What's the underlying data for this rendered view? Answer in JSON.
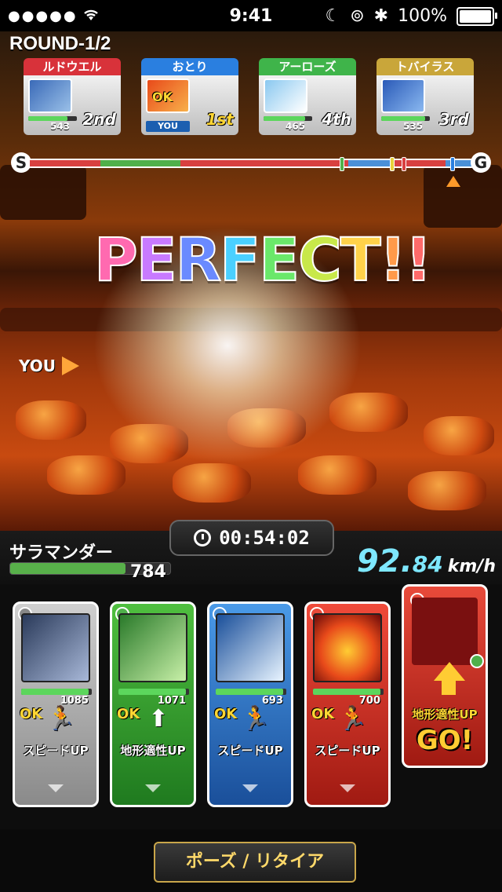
{
  "status_bar": {
    "time": "9:41",
    "battery_label": "100%",
    "battery_level_percent": 100,
    "signal_dots": "●●●●●"
  },
  "race": {
    "round_label": "ROUND-1/2",
    "perfect_text": "PERFECT!!",
    "you_pointer_label": "YOU",
    "start_cap": "S",
    "goal_cap": "G",
    "racers": [
      {
        "name": "ルドウエル",
        "hp": "543",
        "rank": "2nd",
        "plate_color": "#d8323a",
        "hp_fraction": 0.8
      },
      {
        "name": "おとり",
        "hp": "",
        "rank": "1st",
        "plate_color": "#2a7fe0",
        "you_label": "YOU",
        "ok_label": "OK",
        "hp_fraction": 1.0
      },
      {
        "name": "アーローズ",
        "hp": "465",
        "rank": "4th",
        "plate_color": "#3fb44a",
        "hp_fraction": 0.85
      },
      {
        "name": "トバイラス",
        "hp": "535",
        "rank": "3rd",
        "plate_color": "#c9a63a",
        "hp_fraction": 0.9
      }
    ],
    "progress_segments": [
      {
        "from": 0.0,
        "to": 0.08,
        "color": "#d84040"
      },
      {
        "from": 0.08,
        "to": 0.16,
        "color": "#d84040"
      },
      {
        "from": 0.16,
        "to": 0.34,
        "color": "#4fb04a"
      },
      {
        "from": 0.34,
        "to": 0.72,
        "color": "#d84040"
      },
      {
        "from": 0.72,
        "to": 0.82,
        "color": "#4a90d8"
      },
      {
        "from": 0.82,
        "to": 0.94,
        "color": "#d84040"
      },
      {
        "from": 0.94,
        "to": 1.0,
        "color": "#4a90d8"
      }
    ],
    "progress_markers": [
      {
        "position": 0.705,
        "color": "#4fb04a"
      },
      {
        "position": 0.82,
        "color": "#e8d23a"
      },
      {
        "position": 0.845,
        "color": "#d84040"
      },
      {
        "position": 0.955,
        "color": "#2a7fe0"
      }
    ],
    "you_position": 0.955
  },
  "player": {
    "name": "サラマンダー",
    "hp": "784",
    "hp_fraction": 0.72,
    "timer": "00:54:02",
    "speed_int": "92.",
    "speed_frac": "84",
    "speed_unit": "km/h"
  },
  "cards": [
    {
      "color": "gray",
      "hp": "1085",
      "ok": "OK",
      "skill": "スピードUP",
      "skill_icon": "running-figure-icon",
      "orb_color": "#888888",
      "hp_fraction": 0.95
    },
    {
      "color": "green",
      "hp": "1071",
      "ok": "OK",
      "skill": "地形適性UP",
      "skill_icon": "up-arrow-icon",
      "orb_color": "#4fb04a",
      "hp_fraction": 0.95
    },
    {
      "color": "blue",
      "hp": "693",
      "ok": "OK",
      "skill": "スピードUP",
      "skill_icon": "running-figure-icon",
      "orb_color": "#4a90d8",
      "hp_fraction": 0.95
    },
    {
      "color": "red",
      "hp": "700",
      "ok": "OK",
      "skill": "スピードUP",
      "skill_icon": "running-figure-icon",
      "orb_color": "#e84a3a",
      "hp_fraction": 0.95
    }
  ],
  "go_card": {
    "skill": "地形適性UP",
    "go_label": "GO!"
  },
  "bottom": {
    "pause_label": "ポーズ / リタイア"
  }
}
